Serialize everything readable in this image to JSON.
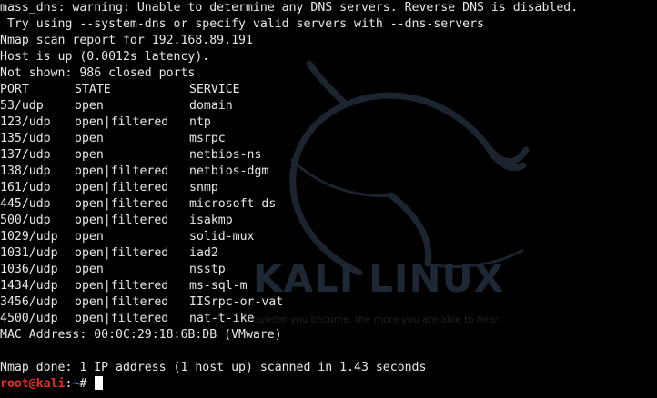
{
  "wallpaper": {
    "logo_text": "KALI LINUX",
    "tagline": "quieter you become, the more you are able to hear",
    "icon": "kali-dragon-icon"
  },
  "terminal": {
    "pre_lines": [
      "mass_dns: warning: Unable to determine any DNS servers. Reverse DNS is disabled.",
      " Try using --system-dns or specify valid servers with --dns-servers",
      "Nmap scan report for 192.168.89.191",
      "Host is up (0.0012s latency).",
      "Not shown: 986 closed ports"
    ],
    "table_header": {
      "port": "PORT",
      "state": "STATE",
      "service": "SERVICE"
    },
    "ports": [
      {
        "port": "53/udp",
        "state": "open",
        "service": "domain"
      },
      {
        "port": "123/udp",
        "state": "open|filtered",
        "service": "ntp"
      },
      {
        "port": "135/udp",
        "state": "open",
        "service": "msrpc"
      },
      {
        "port": "137/udp",
        "state": "open",
        "service": "netbios-ns"
      },
      {
        "port": "138/udp",
        "state": "open|filtered",
        "service": "netbios-dgm"
      },
      {
        "port": "161/udp",
        "state": "open|filtered",
        "service": "snmp"
      },
      {
        "port": "445/udp",
        "state": "open|filtered",
        "service": "microsoft-ds"
      },
      {
        "port": "500/udp",
        "state": "open|filtered",
        "service": "isakmp"
      },
      {
        "port": "1029/udp",
        "state": "open",
        "service": "solid-mux"
      },
      {
        "port": "1031/udp",
        "state": "open|filtered",
        "service": "iad2"
      },
      {
        "port": "1036/udp",
        "state": "open",
        "service": "nsstp"
      },
      {
        "port": "1434/udp",
        "state": "open|filtered",
        "service": "ms-sql-m"
      },
      {
        "port": "3456/udp",
        "state": "open|filtered",
        "service": "IISrpc-or-vat"
      },
      {
        "port": "4500/udp",
        "state": "open|filtered",
        "service": "nat-t-ike"
      }
    ],
    "mac_line": "MAC Address: 00:0C:29:18:6B:DB (VMware)",
    "blank_line": "",
    "done_line": "Nmap done: 1 IP address (1 host up) scanned in 1.43 seconds",
    "prompt": {
      "user_host": "root@kali",
      "separator": ":",
      "path": "~",
      "symbol": "# "
    }
  },
  "colors": {
    "background": "#000000",
    "text": "#e8e8e8",
    "prompt_user": "#ef2a2a",
    "prompt_path": "#5f8fff"
  }
}
